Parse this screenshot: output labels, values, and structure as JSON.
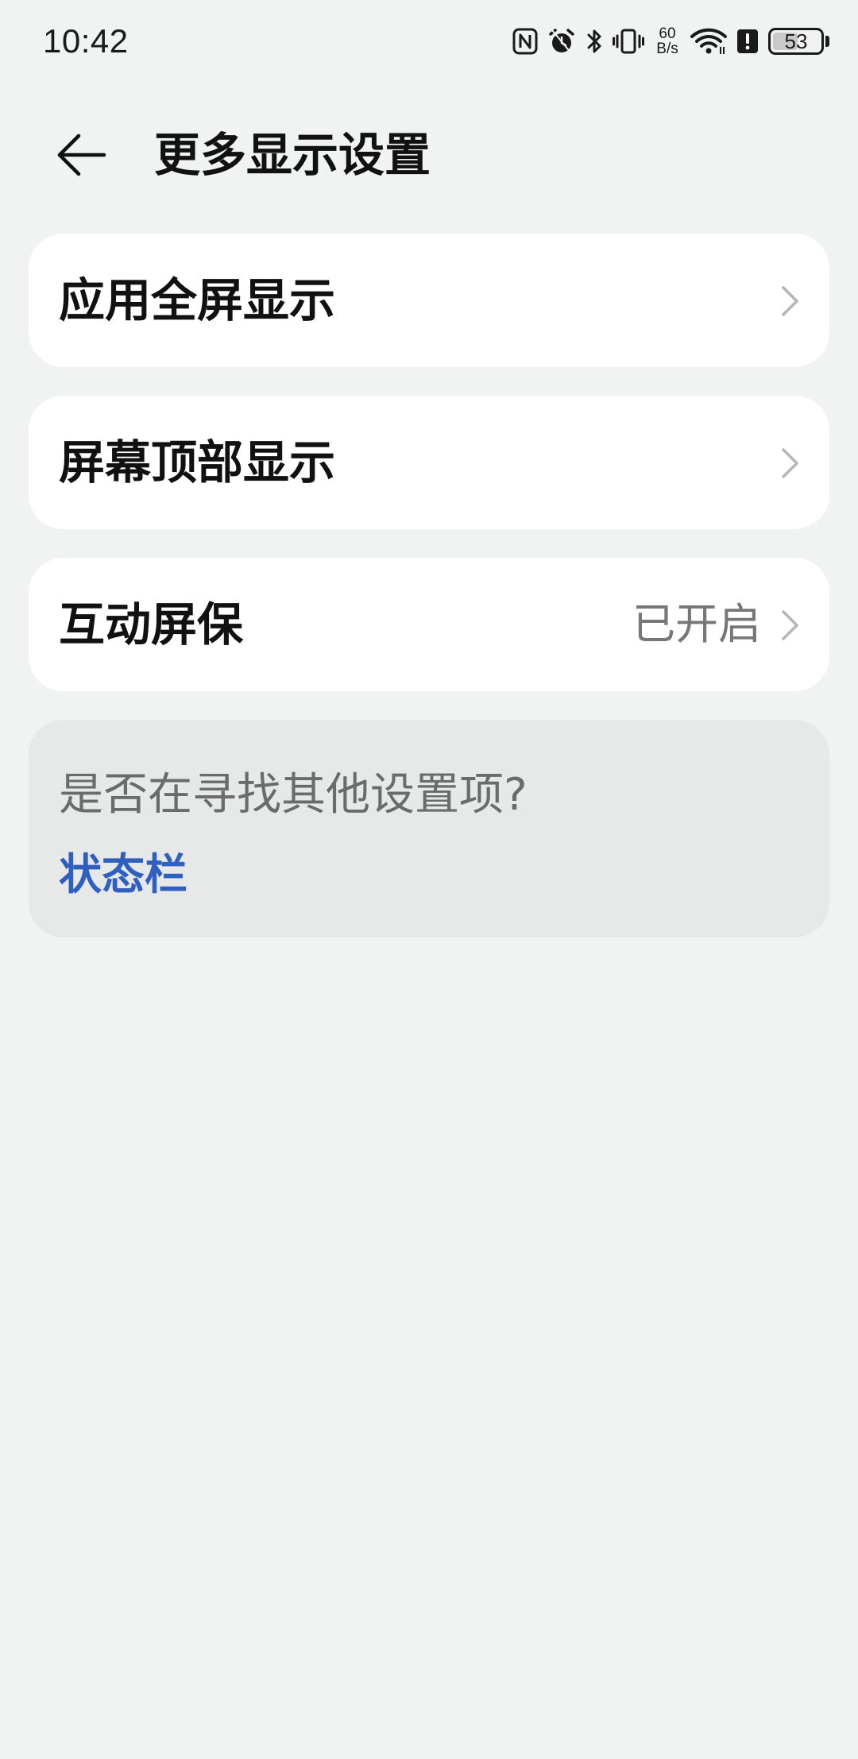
{
  "status_bar": {
    "time": "10:42",
    "net_speed_value": "60",
    "net_speed_unit": "B/s",
    "battery_level": "53",
    "battery_fraction": 0.53,
    "icons": [
      "nfc-icon",
      "alarm-icon",
      "bluetooth-icon",
      "vibrate-icon",
      "wifi-icon",
      "alert-icon",
      "battery-icon"
    ]
  },
  "header": {
    "title": "更多显示设置",
    "back_icon": "arrow-left-icon"
  },
  "settings": [
    {
      "label": "应用全屏显示",
      "value": ""
    },
    {
      "label": "屏幕顶部显示",
      "value": ""
    },
    {
      "label": "互动屏保",
      "value": "已开启"
    }
  ],
  "suggestion": {
    "title": "是否在寻找其他设置项?",
    "link": "状态栏"
  },
  "colors": {
    "background": "#f1f3f3",
    "card": "#ffffff",
    "suggestion_bg": "#e7e9e9",
    "link": "#2f5fbf",
    "secondary_text": "#777777"
  }
}
